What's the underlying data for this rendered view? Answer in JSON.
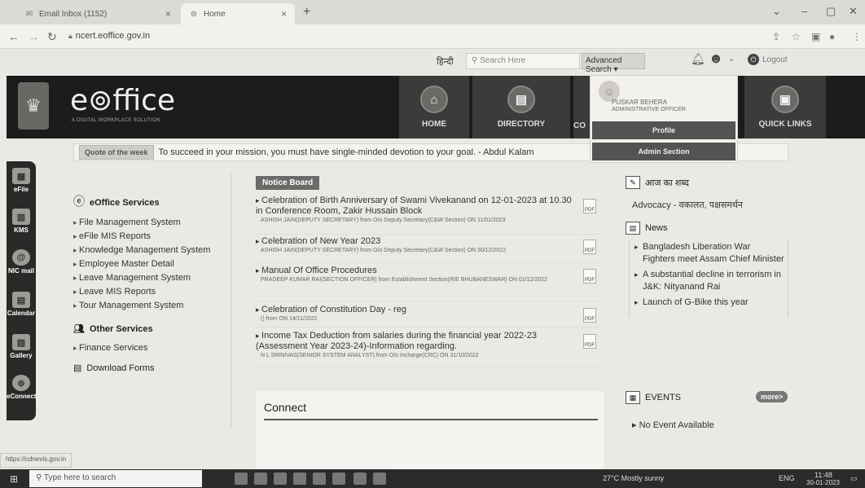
{
  "browser": {
    "tabs": [
      {
        "label": "Email Inbox (1152)",
        "icon": "mail-icon"
      },
      {
        "label": "Home",
        "icon": "eoffice-icon"
      }
    ],
    "url": "ncert.eoffice.gov.in",
    "status_url": "https://cdnevis.gov.in"
  },
  "topbar": {
    "lang": "हिन्दी",
    "search_placeholder": "Search Here",
    "advanced_search": "Advanced Search ▾",
    "logout": "Logout"
  },
  "header": {
    "logo": "e⊚ffice",
    "tagline": "A DIGITAL WORKPLACE SOLUTION",
    "nav": [
      {
        "label": "HOME",
        "icon": "home-icon"
      },
      {
        "label": "DIRECTORY",
        "icon": "directory-icon"
      },
      {
        "label": "CO",
        "icon": ""
      },
      {
        "label": "QUICK LINKS",
        "icon": "quicklinks-icon"
      }
    ]
  },
  "user_menu": {
    "name": "PUSKAR BEHERA",
    "designation": "ADMINISTRATIVE OFFICER",
    "profile": "Profile",
    "admin": "Admin Section"
  },
  "quote": {
    "badge": "Quote of the week",
    "text": "To succeed in your mission, you must have single-minded devotion to your goal. - Abdul Kalam"
  },
  "left_rail": [
    {
      "label": "eFile",
      "icon": "efile-icon"
    },
    {
      "label": "KMS",
      "icon": "kms-icon"
    },
    {
      "label": "NIC mail",
      "icon": "nicmail-icon"
    },
    {
      "label": "Calendar",
      "icon": "calendar-icon"
    },
    {
      "label": "Gallery",
      "icon": "gallery-icon"
    },
    {
      "label": "eConnect",
      "icon": "econnect-icon"
    }
  ],
  "services": {
    "heading": "eOffice Services",
    "items": [
      "File Management System",
      "eFile MIS Reports",
      "Knowledge Management System",
      "Employee Master Detail",
      "Leave Management System",
      "Leave MIS Reports",
      "Tour Management System"
    ],
    "other_heading": "Other Services",
    "other_items": [
      "Finance Services"
    ],
    "download": "Download Forms"
  },
  "notice_board": {
    "title": "Notice Board",
    "items": [
      {
        "title": "Celebration of Birth Anniversary of Swami Vivekanand on 12-01-2023 at 10.30 in Conference Room, Zakir Hussain Block",
        "meta": "ASHISH JAIN(DEPUTY SECRETARY) from O/o Deputy Secretary(C&W Section) ON 11/01/2023"
      },
      {
        "title": "Celebration of New Year 2023",
        "meta": "ASHISH JAIN(DEPUTY SECRETARY) from O/o Deputy Secretary(C&W Section) ON 30/12/2022"
      },
      {
        "title": "Manual Of Office Procedures",
        "meta": "PRADEEP KUMAR RAI(SECTION OFFICER) from Establishment Section(RIE BHUBANESWAR) ON 01/12/2022"
      },
      {
        "title": "Celebration of Constitution Day - reg",
        "meta": "() from ON 14/11/2022"
      },
      {
        "title": "Income Tax Deduction from salaries during the financial year 2022-23 (Assessment Year 2023-24)-Information regarding.",
        "meta": "N L SRINIVAS(SENIOR SYSTEM ANALYST) from O/o Incharge(CRC) ON 31/10/2022"
      }
    ]
  },
  "connect": {
    "title": "Connect"
  },
  "right": {
    "word_heading": "आज का शब्द",
    "word": "Advocacy - वकालत, पक्षसमर्थन",
    "news_heading": "News",
    "news": [
      "Bangladesh Liberation War Fighters meet Assam Chief Minister",
      "A substantial decline in terrorism in J&K: Nityanand Rai",
      "Launch of G-Bike this year"
    ],
    "events_heading": "EVENTS",
    "more": "more>",
    "events": [
      "No Event Available"
    ]
  },
  "taskbar": {
    "search_placeholder": "Type here to search",
    "weather": "27°C Mostly sunny",
    "lang": "ENG",
    "time": "11:48",
    "date": "30-01-2023"
  }
}
